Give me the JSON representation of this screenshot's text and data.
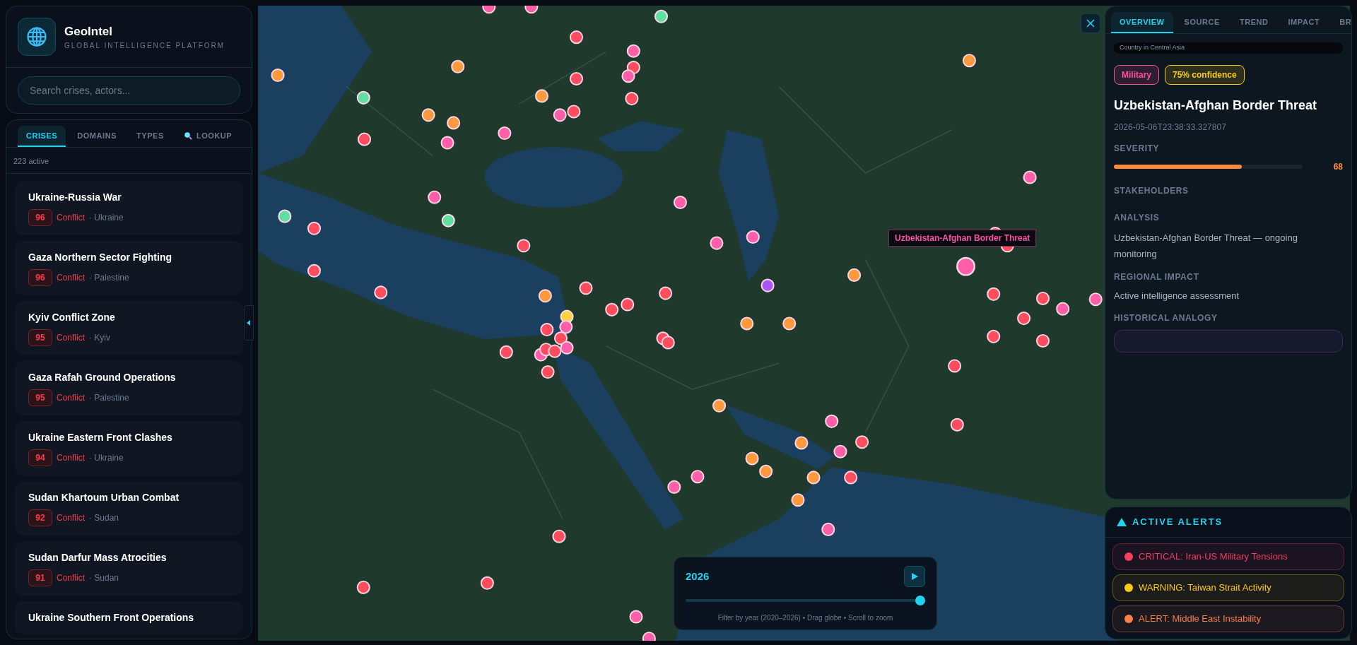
{
  "brand": {
    "title": "GeoIntel",
    "subtitle": "GLOBAL INTELLIGENCE PLATFORM"
  },
  "search": {
    "placeholder": "Search crises, actors..."
  },
  "tabs": [
    {
      "label": "CRISES",
      "selected": true,
      "kind": "text"
    },
    {
      "label": "DOMAINS",
      "selected": false,
      "kind": "text"
    },
    {
      "label": "TYPES",
      "selected": false,
      "kind": "text"
    },
    {
      "label": "LOOKUP",
      "selected": false,
      "kind": "search"
    }
  ],
  "active_count": "223 active",
  "crises": [
    {
      "title": "Ukraine-Russia War",
      "score": "96",
      "type": "Conflict",
      "location": "· Ukraine"
    },
    {
      "title": "Gaza Northern Sector Fighting",
      "score": "96",
      "type": "Conflict",
      "location": "· Palestine"
    },
    {
      "title": "Kyiv Conflict Zone",
      "score": "95",
      "type": "Conflict",
      "location": "· Kyiv"
    },
    {
      "title": "Gaza Rafah Ground Operations",
      "score": "95",
      "type": "Conflict",
      "location": "· Palestine"
    },
    {
      "title": "Ukraine Eastern Front Clashes",
      "score": "94",
      "type": "Conflict",
      "location": "· Ukraine"
    },
    {
      "title": "Sudan Khartoum Urban Combat",
      "score": "92",
      "type": "Conflict",
      "location": "· Sudan"
    },
    {
      "title": "Sudan Darfur Mass Atrocities",
      "score": "91",
      "type": "Conflict",
      "location": "· Sudan"
    },
    {
      "title": "Ukraine Southern Front Operations"
    }
  ],
  "map": {
    "tooltip": "Uzbekistan-Afghan Border Threat"
  },
  "timeline": {
    "year": "2026",
    "level": 1,
    "hint": "Filter by year (2020–2026) • Drag globe • Scroll to zoom"
  },
  "detail": {
    "tabs": [
      {
        "label": "OVERVIEW",
        "selected": true
      },
      {
        "label": "SOURCE",
        "selected": false
      },
      {
        "label": "TREND",
        "selected": false
      },
      {
        "label": "IMPACT",
        "selected": false
      },
      {
        "label": "BR",
        "selected": false
      }
    ],
    "region": "Country in Central Asia",
    "tags": [
      {
        "label": "Military",
        "color": "#ff4fa3"
      },
      {
        "label": "75% confidence",
        "color": "#facc15"
      }
    ],
    "title": "Uzbekistan-Afghan Border Threat",
    "timestamp": "2026-05-06T23:38:33.327807",
    "severity_label": "SEVERITY",
    "severity": {
      "level": 0.68,
      "reading": "68"
    },
    "stakeholders_label": "STAKEHOLDERS",
    "analysis_label": "ANALYSIS",
    "analysis": "Uzbekistan-Afghan Border Threat — ongoing monitoring",
    "impact_label": "REGIONAL IMPACT",
    "impact": "Active intelligence assessment",
    "analogy_label": "HISTORICAL ANALOGY"
  },
  "alerts": {
    "title": "ACTIVE ALERTS",
    "items": [
      {
        "text": "CRITICAL: Iran-US Military Tensions",
        "color": "#f43f5e"
      },
      {
        "text": "WARNING: Taiwan Strait Activity",
        "color": "#facc15"
      },
      {
        "text": "ALERT: Middle East Instability",
        "color": "#fb7f4a"
      }
    ]
  }
}
